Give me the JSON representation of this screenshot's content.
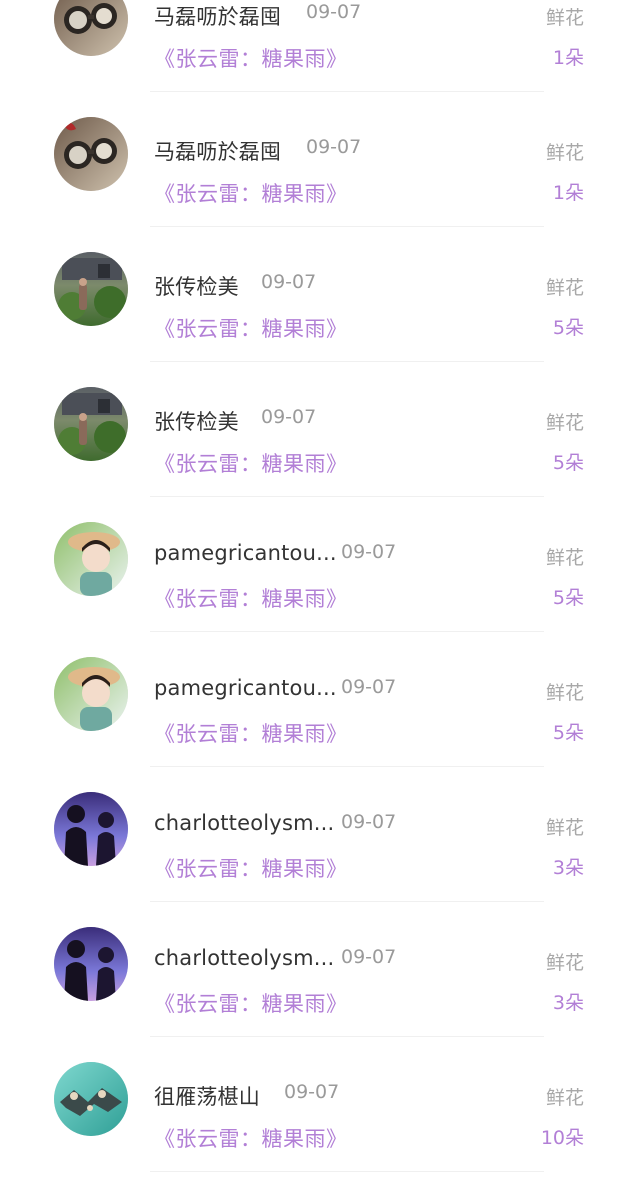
{
  "rows": [
    {
      "name": "马磊呖於磊囤",
      "date": "09-07",
      "gift": "《张云雷：糖果雨》",
      "type": "鲜花",
      "quantity": "1朵",
      "avatar": "vintage-goggles-avatar"
    },
    {
      "name": "马磊呖於磊囤",
      "date": "09-07",
      "gift": "《张云雷：糖果雨》",
      "type": "鲜花",
      "quantity": "1朵",
      "avatar": "vintage-goggles-avatar"
    },
    {
      "name": "张传检美",
      "date": "09-07",
      "gift": "《张云雷：糖果雨》",
      "type": "鲜花",
      "quantity": "5朵",
      "avatar": "garden-house-avatar"
    },
    {
      "name": "张传检美",
      "date": "09-07",
      "gift": "《张云雷：糖果雨》",
      "type": "鲜花",
      "quantity": "5朵",
      "avatar": "garden-house-avatar"
    },
    {
      "name": "pamegricantou...",
      "date": "09-07",
      "gift": "《张云雷：糖果雨》",
      "type": "鲜花",
      "quantity": "5朵",
      "avatar": "girl-hat-avatar"
    },
    {
      "name": "pamegricantou...",
      "date": "09-07",
      "gift": "《张云雷：糖果雨》",
      "type": "鲜花",
      "quantity": "5朵",
      "avatar": "girl-hat-avatar"
    },
    {
      "name": "charlotteolysm...",
      "date": "09-07",
      "gift": "《张云雷：糖果雨》",
      "type": "鲜花",
      "quantity": "3朵",
      "avatar": "couple-silhouette-avatar"
    },
    {
      "name": "charlotteolysm...",
      "date": "09-07",
      "gift": "《张云雷：糖果雨》",
      "type": "鲜花",
      "quantity": "3朵",
      "avatar": "couple-silhouette-avatar"
    },
    {
      "name": "徂雁荡椹山",
      "date": "09-07",
      "gift": "《张云雷：糖果雨》",
      "type": "鲜花",
      "quantity": "10朵",
      "avatar": "teal-pattern-avatar"
    }
  ],
  "colors": {
    "accent": "#b27fd6",
    "name": "#333333",
    "muted": "#9a9a9a",
    "divider": "#f0f0f0"
  }
}
